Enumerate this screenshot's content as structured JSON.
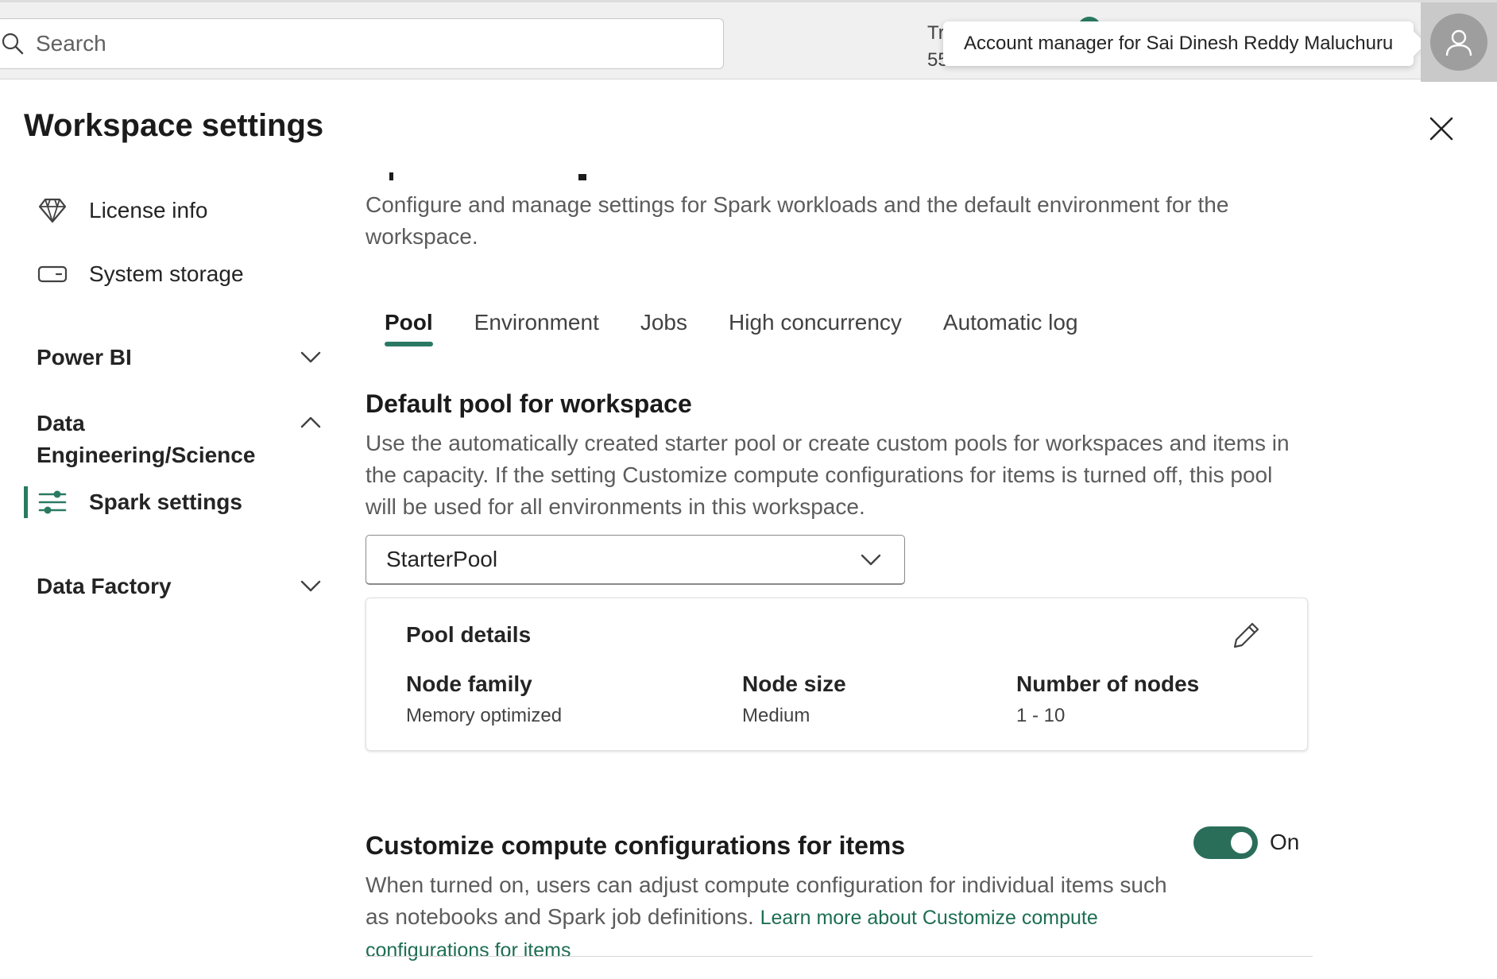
{
  "topbar": {
    "search_placeholder": "Search",
    "truncated_line1": "Tr",
    "truncated_line2": "55",
    "tooltip": "Account manager for Sai Dinesh Reddy Maluchuru"
  },
  "dialog": {
    "title": "Workspace settings"
  },
  "sidebar": {
    "items": [
      {
        "label": "License info",
        "icon": "diamond-icon"
      },
      {
        "label": "System storage",
        "icon": "storage-icon"
      }
    ],
    "groups": [
      {
        "label": "Power BI",
        "expanded": false
      },
      {
        "label": "Data Engineering/Science",
        "expanded": true,
        "children": [
          {
            "label": "Spark settings",
            "icon": "sliders-icon",
            "active": true
          }
        ]
      },
      {
        "label": "Data Factory",
        "expanded": false
      }
    ]
  },
  "main": {
    "description": "Configure and manage settings for Spark workloads and the default environment for the workspace.",
    "tabs": [
      {
        "label": "Pool",
        "active": true
      },
      {
        "label": "Environment",
        "active": false
      },
      {
        "label": "Jobs",
        "active": false
      },
      {
        "label": "High concurrency",
        "active": false
      },
      {
        "label": "Automatic log",
        "active": false
      }
    ],
    "default_pool": {
      "heading": "Default pool for workspace",
      "description": "Use the automatically created starter pool or create custom pools for workspaces and items in the capacity. If the setting Customize compute configurations for items is turned off, this pool will be used for all environments in this workspace.",
      "selected": "StarterPool"
    },
    "pool_details": {
      "title": "Pool details",
      "fields": [
        {
          "label": "Node family",
          "value": "Memory optimized"
        },
        {
          "label": "Node size",
          "value": "Medium"
        },
        {
          "label": "Number of nodes",
          "value": "1 - 10"
        }
      ]
    },
    "customize": {
      "heading": "Customize compute configurations for items",
      "description": "When turned on, users can adjust compute configuration for individual items such as notebooks and Spark job definitions.",
      "link": "Learn more about Customize compute configurations for items",
      "toggle_on": true,
      "toggle_label": "On"
    }
  },
  "colors": {
    "accent": "#2a7a62",
    "toggle": "#2a6e5a",
    "link": "#1e6e52"
  }
}
